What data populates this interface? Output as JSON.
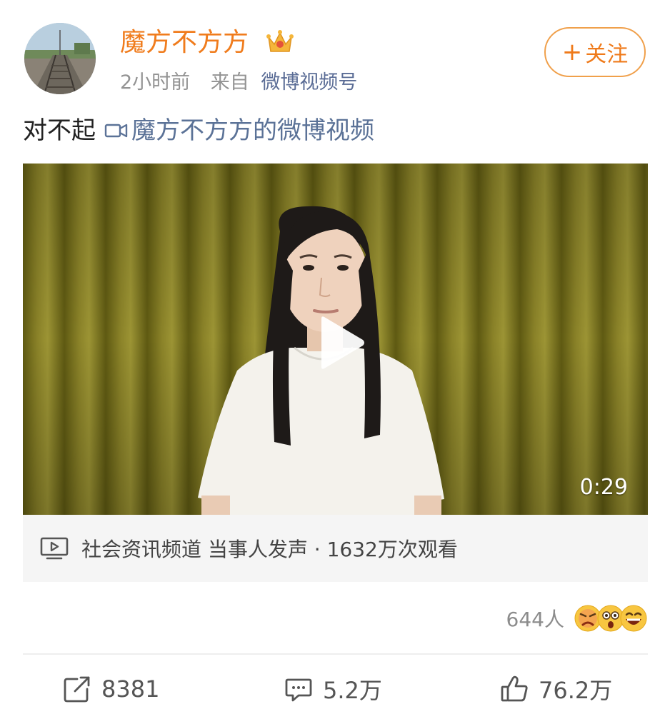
{
  "post": {
    "username": "魔方不方方",
    "time": "2小时前",
    "from_prefix": "来自",
    "source": "微博视频号",
    "follow_label": "关注",
    "text": "对不起",
    "video_link": "魔方不方方的微博视频"
  },
  "video": {
    "duration": "0:29",
    "channel_info": "社会资讯频道 当事人发声 · 1632万次观看"
  },
  "reactions": {
    "count": "644人"
  },
  "actions": {
    "repost": "8381",
    "comment": "5.2万",
    "like": "76.2万"
  },
  "colors": {
    "accent": "#f07c1d",
    "link": "#5b7297",
    "curtain": "#7a7420"
  },
  "icons": [
    "vip-crown-icon",
    "video-camera-icon",
    "play-icon",
    "tv-icon",
    "repost-icon",
    "comment-icon",
    "like-icon"
  ]
}
